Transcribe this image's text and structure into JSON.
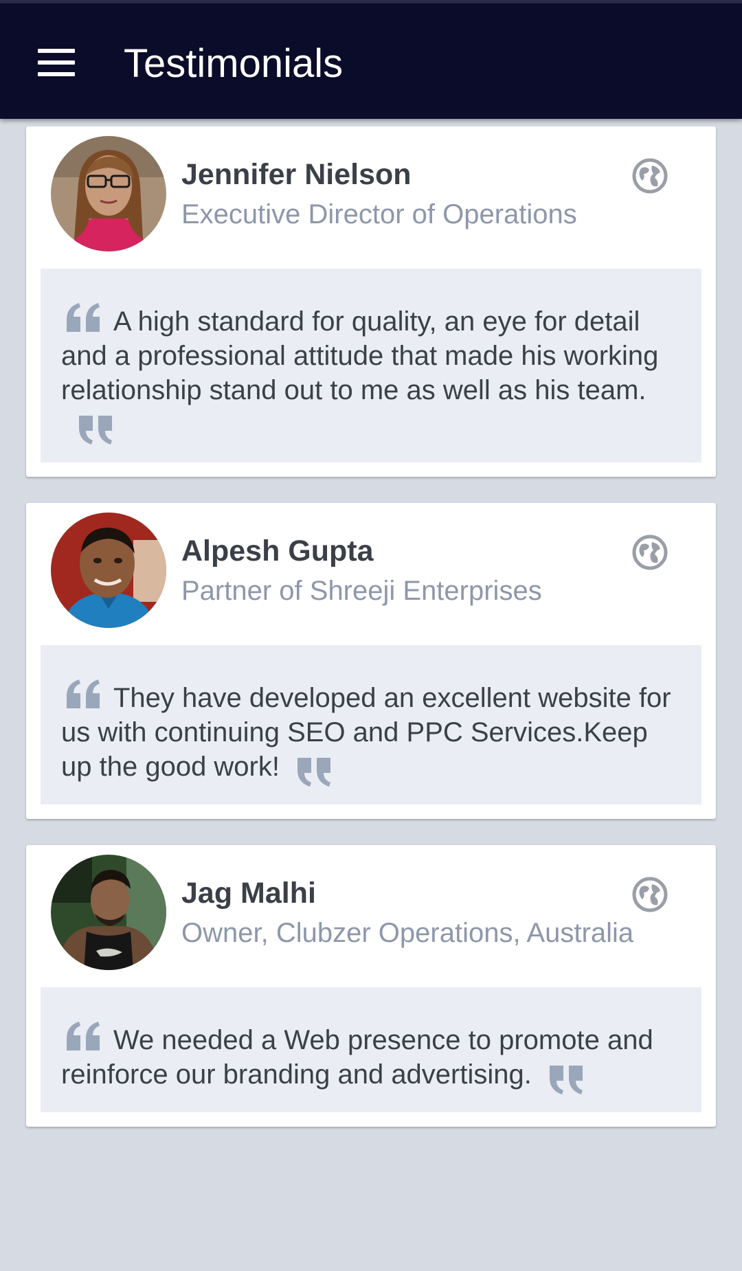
{
  "app_bar": {
    "title": "Testimonials",
    "menu_icon": "hamburger-menu-icon",
    "background": "#0b0b2a"
  },
  "testimonials": [
    {
      "name": "Jennifer Nielson",
      "role": "Executive Director of Operations",
      "quote": "A high standard for quality, an eye for detail and a professional attitude that made his working relationship stand out to me as well as his team.",
      "link_icon": "globe-icon"
    },
    {
      "name": "Alpesh Gupta",
      "role": "Partner of Shreeji Enterprises",
      "quote": "They have developed an excellent website for us with continuing SEO and PPC Services.Keep up the good work!",
      "link_icon": "globe-icon"
    },
    {
      "name": "Jag Malhi",
      "role": "Owner, Clubzer Operations, Australia",
      "quote": "We needed a Web presence to promote and reinforce our branding and advertising.",
      "link_icon": "globe-icon"
    }
  ],
  "colors": {
    "page_background": "#d6dbe3",
    "name_text": "#3b3f47",
    "role_text": "#8d97aa",
    "quote_background": "#eaedf3",
    "quote_mark": "#9aa6ba",
    "globe_icon": "#9a9ea6"
  }
}
